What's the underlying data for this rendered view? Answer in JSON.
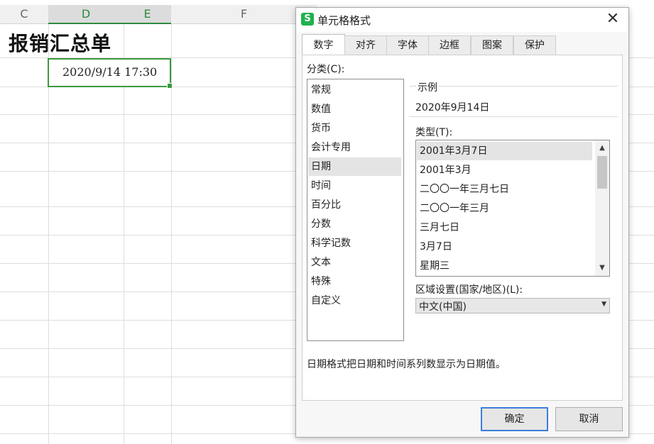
{
  "sheet": {
    "columns": [
      "C",
      "D",
      "E",
      "F"
    ],
    "title": "报销汇总单",
    "selected_cell_value": "2020/9/14 17:30"
  },
  "dialog": {
    "title": "单元格格式",
    "app_icon": "S",
    "close_icon": "close-icon",
    "tabs": [
      "数字",
      "对齐",
      "字体",
      "边框",
      "图案",
      "保护"
    ],
    "active_tab": "数字",
    "category_label": "分类(C):",
    "categories": [
      "常规",
      "数值",
      "货币",
      "会计专用",
      "日期",
      "时间",
      "百分比",
      "分数",
      "科学记数",
      "文本",
      "特殊",
      "自定义"
    ],
    "selected_category": "日期",
    "sample_label": "示例",
    "sample_value": "2020年9月14日",
    "type_label": "类型(T):",
    "types": [
      "2001年3月7日",
      "2001年3月",
      "二〇〇一年三月七日",
      "二〇〇一年三月",
      "三月七日",
      "3月7日",
      "星期三"
    ],
    "selected_type": "2001年3月7日",
    "region_label": "区域设置(国家/地区)(L):",
    "region_value": "中文(中国)",
    "description": "日期格式把日期和时间系列数显示为日期值。",
    "ok_label": "确定",
    "cancel_label": "取消",
    "accent_color": "#3d7edc",
    "app_icon_color": "#1fb14c",
    "selection_color": "#3a9a3f"
  }
}
